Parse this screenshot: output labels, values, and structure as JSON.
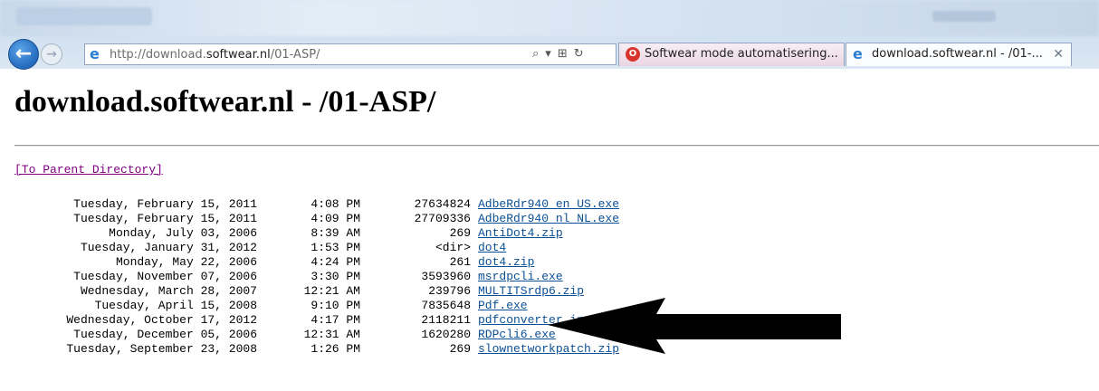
{
  "browser": {
    "url_prefix": "http://download.",
    "url_domain": "softwear.nl",
    "url_path": "/01-ASP/",
    "search_icon": "⌕",
    "dropdown_icon": "▾",
    "compat_icon": "⊞",
    "refresh_icon": "↻",
    "tabs": [
      {
        "label": "Softwear mode automatisering...",
        "icon": "opera-icon"
      },
      {
        "label": "download.softwear.nl - /01-...",
        "icon": "ie-icon",
        "close": "✕"
      }
    ]
  },
  "page": {
    "title": "download.softwear.nl - /01-ASP/",
    "parent_link": "[To Parent Directory]"
  },
  "listing": [
    {
      "date": "Tuesday, February 15, 2011",
      "time": "4:08 PM",
      "size": "27634824",
      "name": "AdbeRdr940_en_US.exe"
    },
    {
      "date": "Tuesday, February 15, 2011",
      "time": "4:09 PM",
      "size": "27709336",
      "name": "AdbeRdr940_nl_NL.exe"
    },
    {
      "date": "Monday, July 03, 2006",
      "time": "8:39 AM",
      "size": "269",
      "name": "AntiDot4.zip"
    },
    {
      "date": "Tuesday, January 31, 2012",
      "time": "1:53 PM",
      "size": "<dir>",
      "name": "dot4"
    },
    {
      "date": "Monday, May 22, 2006",
      "time": "4:24 PM",
      "size": "261",
      "name": "dot4.zip"
    },
    {
      "date": "Tuesday, November 07, 2006",
      "time": "3:30 PM",
      "size": "3593960",
      "name": "msrdpcli.exe"
    },
    {
      "date": "Wednesday, March 28, 2007",
      "time": "12:21 AM",
      "size": "239796",
      "name": "MULTITSrdp6.zip"
    },
    {
      "date": "Tuesday, April 15, 2008",
      "time": "9:10 PM",
      "size": "7835648",
      "name": "Pdf.exe"
    },
    {
      "date": "Wednesday, October 17, 2012",
      "time": "4:17 PM",
      "size": "2118211",
      "name": "pdfconverter install....pdf"
    },
    {
      "date": "Tuesday, December 05, 2006",
      "time": "12:31 AM",
      "size": "1620280",
      "name": "RDPcli6.exe"
    },
    {
      "date": "Tuesday, September 23, 2008",
      "time": "1:26 PM",
      "size": "269",
      "name": "slownetworkpatch.zip"
    }
  ],
  "annotation": {
    "type": "arrow",
    "color": "#000000",
    "points_to": "Pdf.exe"
  }
}
